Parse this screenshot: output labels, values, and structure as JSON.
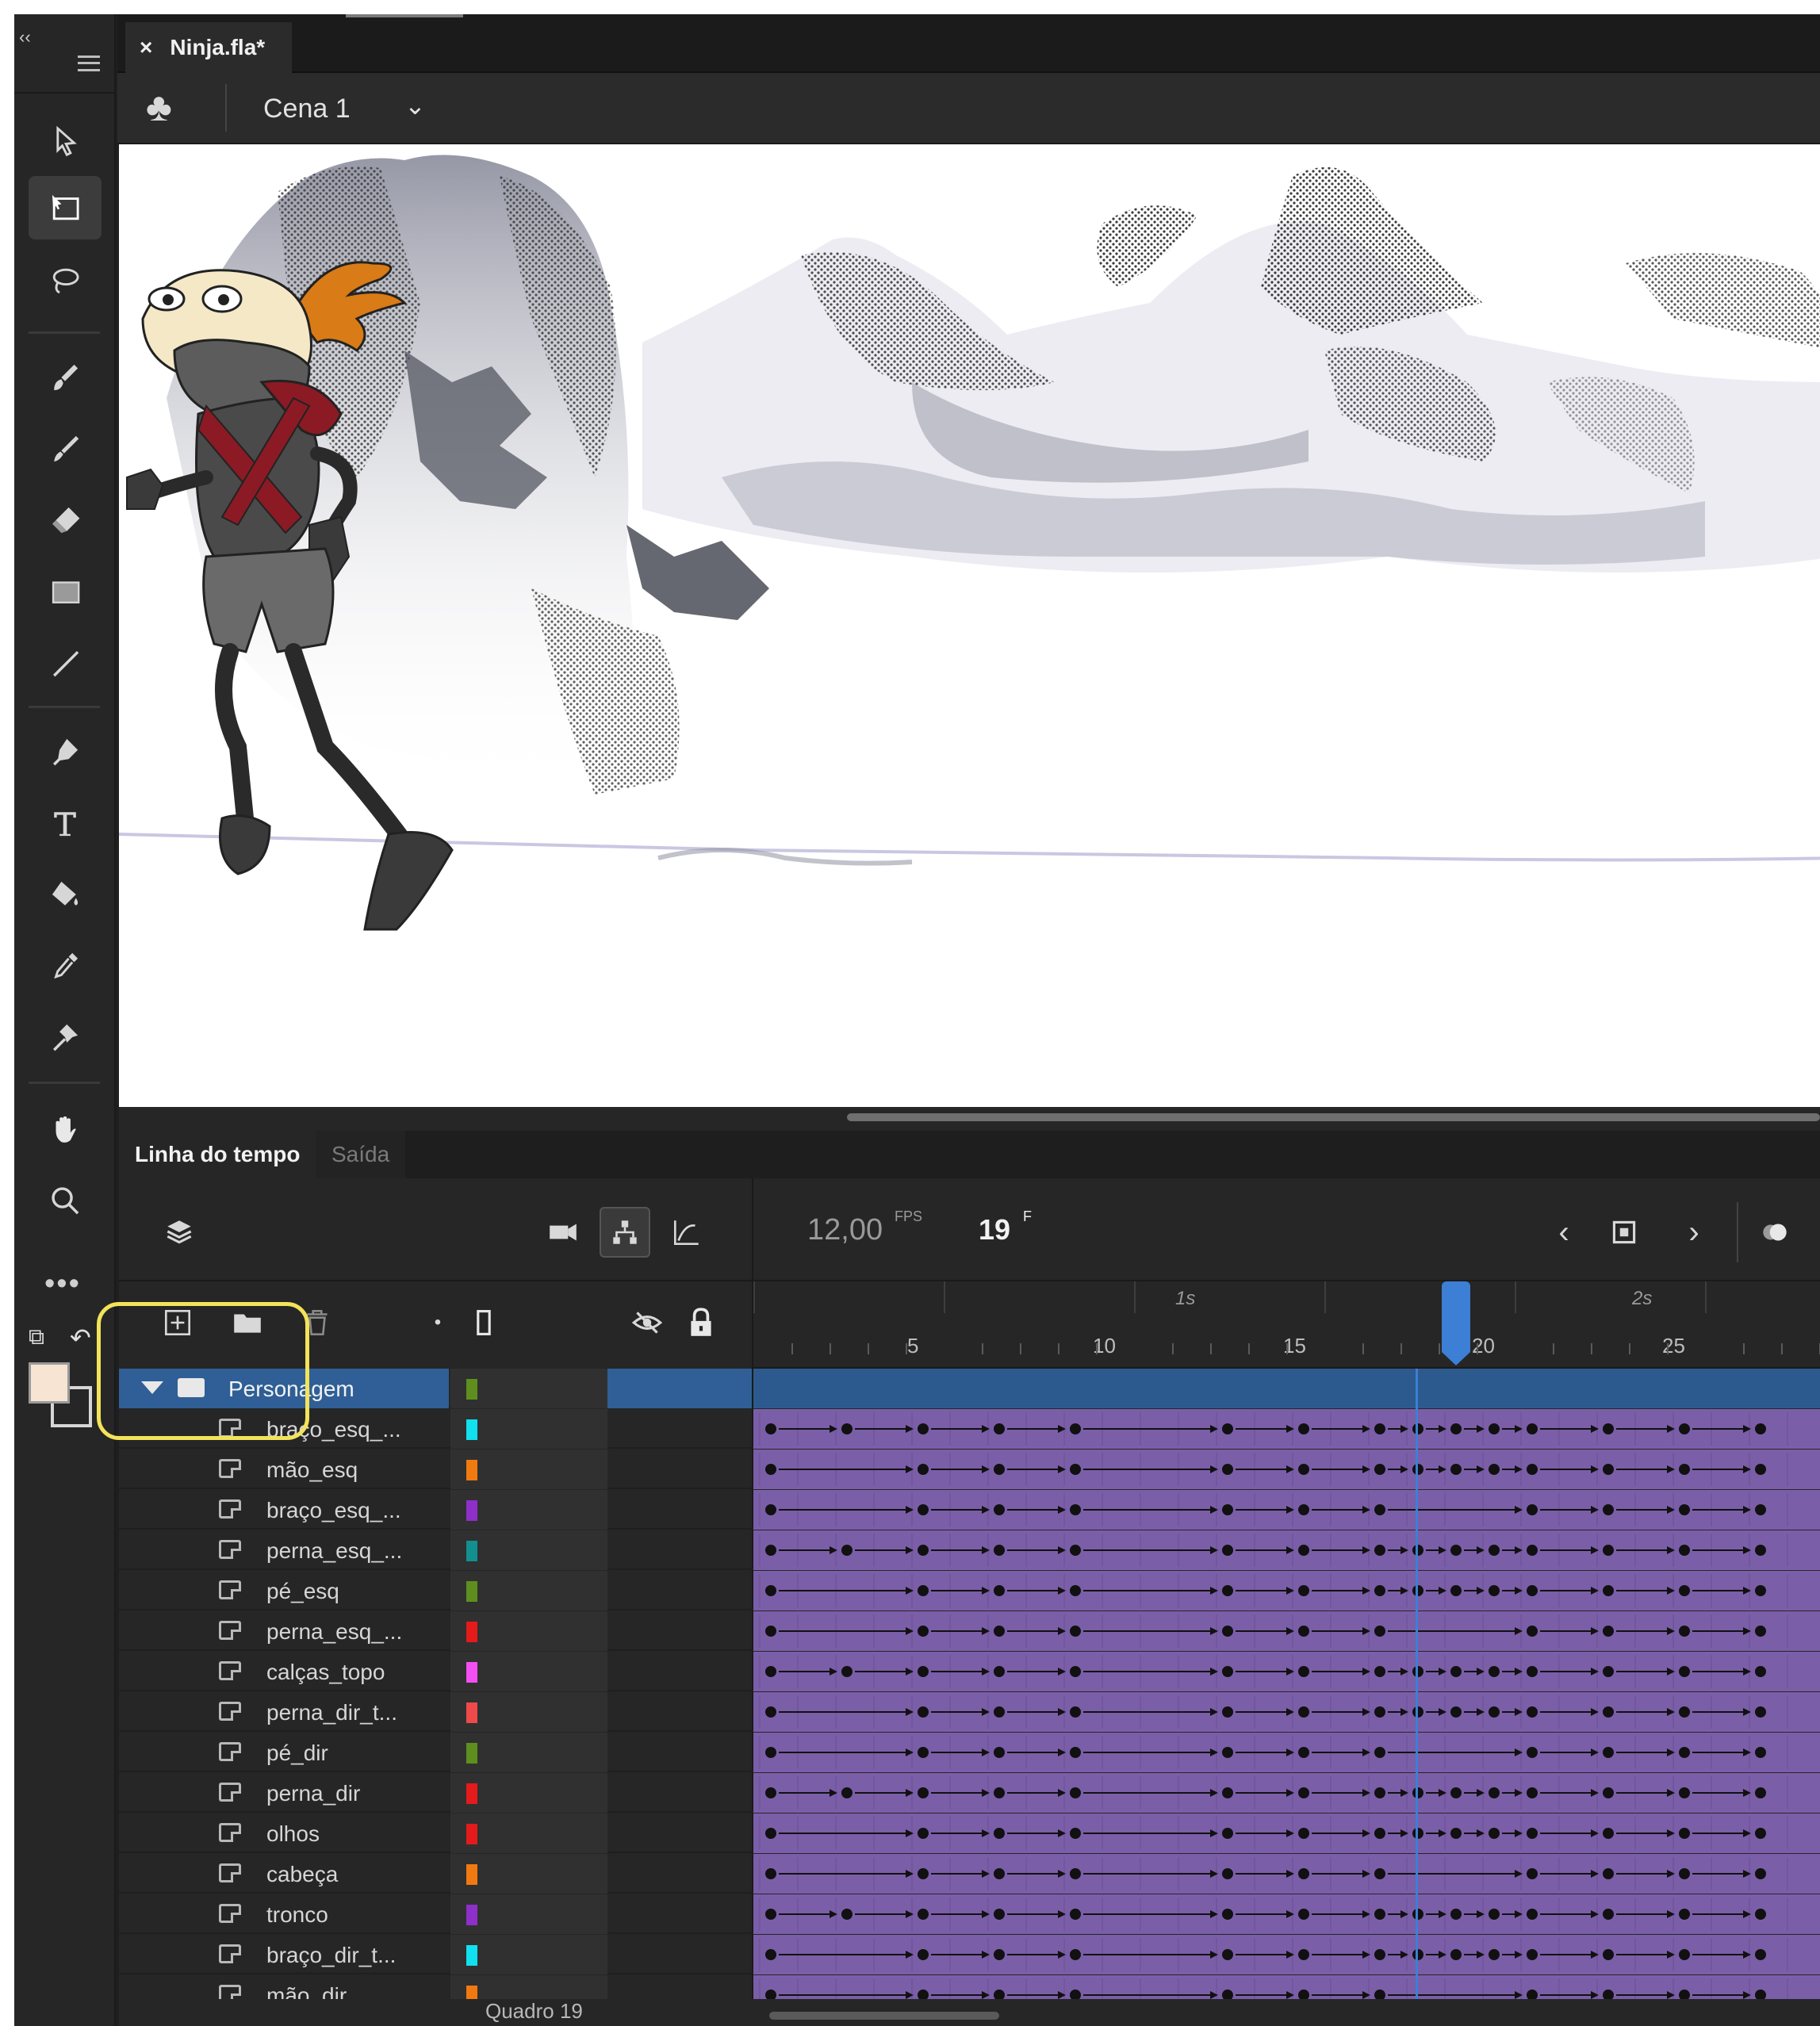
{
  "document": {
    "tab_title": "Ninja.fla*",
    "close_glyph": "×"
  },
  "scene": {
    "name": "Cena 1"
  },
  "toolbar": {
    "tools": [
      "selection-tool",
      "free-transform-tool",
      "lasso-tool",
      "paint-brush-tool",
      "brush-tool",
      "eraser-tool",
      "rectangle-tool",
      "line-tool",
      "pen-tool",
      "text-tool",
      "paint-bucket-tool",
      "eyedropper-tool",
      "bone-tool",
      "hand-tool",
      "zoom-tool",
      "more-tools"
    ],
    "fill_color": "#f8e4d2"
  },
  "timeline": {
    "tabs": [
      "Linha do tempo",
      "Saída"
    ],
    "fps_value": "12,00",
    "fps_unit": "FPS",
    "current_frame": "19",
    "frame_unit": "F",
    "ruler": {
      "numbers": [
        "5",
        "10",
        "15",
        "20",
        "25"
      ],
      "seconds": [
        "1s",
        "2s"
      ]
    },
    "status_label": "Quadro  19",
    "layers": [
      {
        "name": "Personagem",
        "color": "#5e8f1e",
        "type": "folder"
      },
      {
        "name": "braço_esq_...",
        "color": "#11e0ee"
      },
      {
        "name": "mão_esq",
        "color": "#f07a10"
      },
      {
        "name": "braço_esq_...",
        "color": "#8e2fc9"
      },
      {
        "name": "perna_esq_...",
        "color": "#128f8f"
      },
      {
        "name": "pé_esq",
        "color": "#5e8f1e"
      },
      {
        "name": "perna_esq_...",
        "color": "#e51a1a"
      },
      {
        "name": "calças_topo",
        "color": "#f24ff2"
      },
      {
        "name": "perna_dir_t...",
        "color": "#ee4a4a"
      },
      {
        "name": "pé_dir",
        "color": "#5e8f1e"
      },
      {
        "name": "perna_dir",
        "color": "#e51a1a"
      },
      {
        "name": "olhos",
        "color": "#e51a1a"
      },
      {
        "name": "cabeça",
        "color": "#f07a10"
      },
      {
        "name": "tronco",
        "color": "#8e2fc9"
      },
      {
        "name": "braço_dir_t...",
        "color": "#11e0ee"
      },
      {
        "name": "mão_dir",
        "color": "#f07a10"
      }
    ]
  },
  "colors": {
    "accent": "#3c7fd4",
    "frame_purple": "#7b5ea8",
    "highlight": "#f3e35a"
  }
}
